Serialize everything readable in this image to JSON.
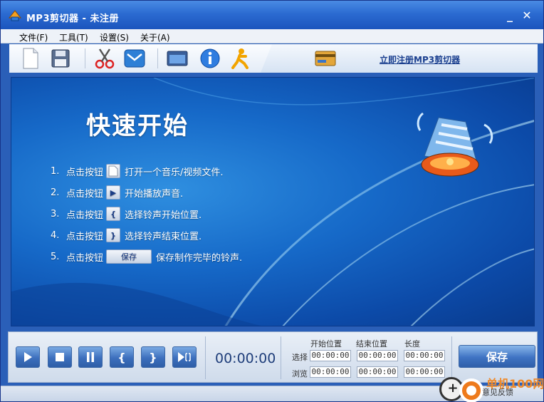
{
  "window": {
    "title": "MP3剪切器 - 未注册",
    "minimize_label": "_",
    "close_label": "✕"
  },
  "menu": {
    "items": [
      "文件(F)",
      "工具(T)",
      "设置(S)",
      "关于(A)"
    ]
  },
  "toolbar": {
    "buttons": [
      "new-file-icon",
      "save-disk-icon",
      "scissors-icon",
      "mail-icon",
      "window-icon",
      "info-icon",
      "runner-icon"
    ],
    "register_link": "立即注册MP3剪切器",
    "card_icon": "credit-card-icon"
  },
  "quickstart": {
    "title": "快速开始",
    "steps": [
      {
        "num": "1.",
        "pre": "点击按钮",
        "btn": "",
        "post": "打开一个音乐/视频文件."
      },
      {
        "num": "2.",
        "pre": "点击按钮",
        "btn": "▶",
        "post": "开始播放声音."
      },
      {
        "num": "3.",
        "pre": "点击按钮",
        "btn": "{",
        "post": "选择铃声开始位置."
      },
      {
        "num": "4.",
        "pre": "点击按钮",
        "btn": "}",
        "post": "选择铃声结束位置."
      },
      {
        "num": "5.",
        "pre": "点击按钮",
        "btn": "保存",
        "post": "保存制作完毕的铃声."
      }
    ]
  },
  "controls": {
    "buttons": [
      "play-icon",
      "stop-icon",
      "pause-icon",
      "start-bracket-icon",
      "end-bracket-icon",
      "play-selection-icon"
    ],
    "time": "00:00:00",
    "headers": {
      "start": "开始位置",
      "end": "结束位置",
      "length": "长度"
    },
    "rows": [
      {
        "label": "选择",
        "start": "00:00:00",
        "end": "00:00:00",
        "length": "00:00:00"
      },
      {
        "label": "浏览",
        "start": "00:00:00",
        "end": "00:00:00",
        "length": "00:00:00"
      }
    ],
    "save_label": "保存"
  },
  "watermark": {
    "site": "单机100网",
    "feedback": "意见反馈"
  },
  "colors": {
    "titlebar": "#2b6bd1",
    "panel": "#1669c8",
    "accent": "#f08a2a"
  }
}
